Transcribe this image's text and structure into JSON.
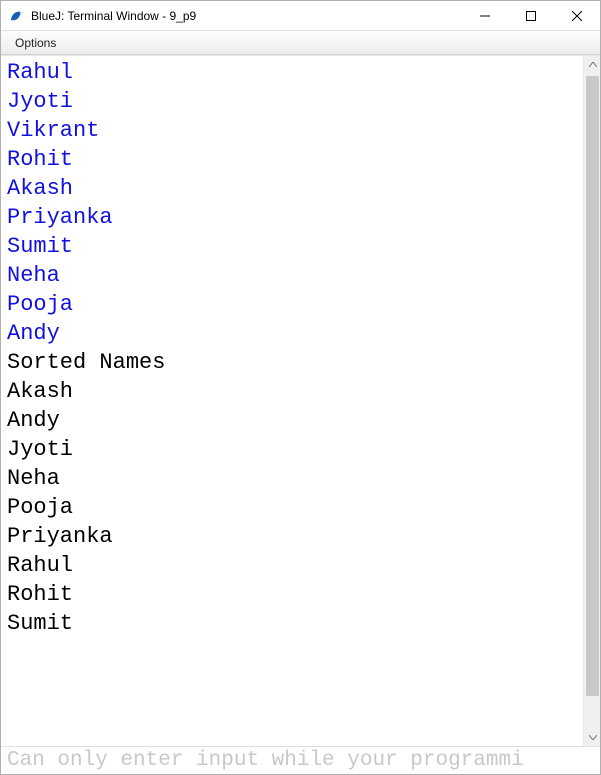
{
  "window": {
    "title": "BlueJ: Terminal Window - 9_p9"
  },
  "menubar": {
    "options": "Options"
  },
  "terminal": {
    "user_input_lines": [
      "Rahul",
      "Jyoti",
      "Vikrant",
      "Rohit",
      "Akash",
      "Priyanka",
      "Sumit",
      "Neha",
      "Pooja",
      "Andy"
    ],
    "output_lines": [
      "Sorted Names",
      "Akash",
      "Andy",
      "Jyoti",
      "Neha",
      "Pooja",
      "Priyanka",
      "Rahul",
      "Rohit",
      "Sumit"
    ]
  },
  "statusbar": {
    "message": "Can only enter input while your programmi"
  },
  "icons": {
    "app": "bluej-bird-icon",
    "minimize": "minimize-icon",
    "maximize": "maximize-icon",
    "close": "close-icon",
    "scroll_up": "chevron-up-icon",
    "scroll_down": "chevron-down-icon"
  }
}
